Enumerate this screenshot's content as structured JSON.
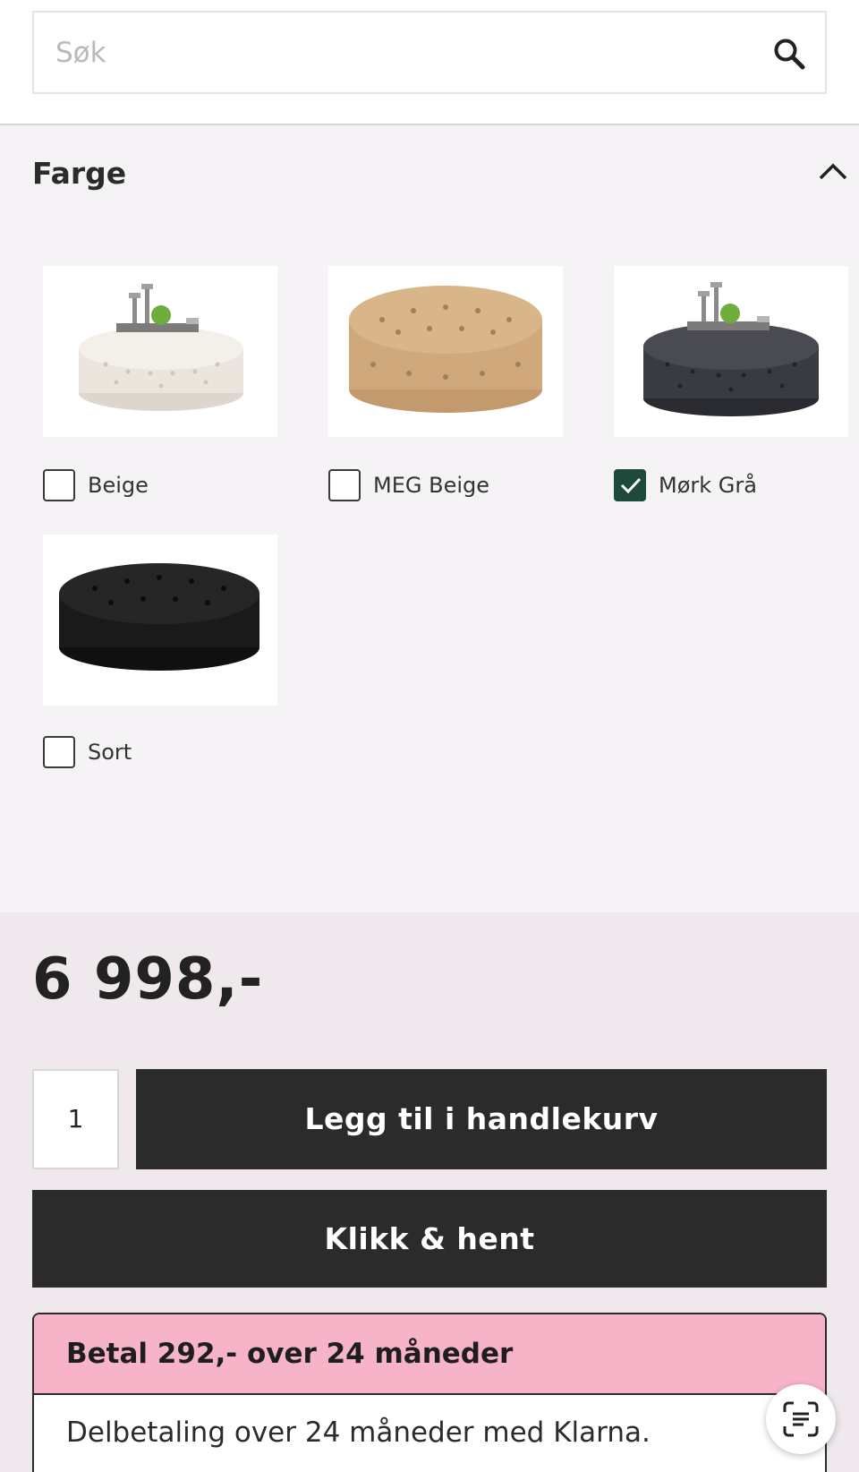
{
  "search": {
    "placeholder": "Søk"
  },
  "filter": {
    "title": "Farge",
    "options": [
      {
        "label": "Beige",
        "checked": false
      },
      {
        "label": "MEG Beige",
        "checked": false
      },
      {
        "label": "Mørk Grå",
        "checked": true
      },
      {
        "label": "Sort",
        "checked": false
      }
    ]
  },
  "product": {
    "price": "6 998,-",
    "quantity": "1",
    "add_to_cart_label": "Legg til i handlekurv",
    "click_collect_label": "Klikk & hent"
  },
  "klarna": {
    "heading": "Betal 292,- over 24 måneder",
    "text": "Delbetaling over 24 måneder med Klarna."
  },
  "colors": {
    "accent_checked": "#1f4a3b",
    "button_bg": "#2b2b2b",
    "klarna_pink": "#f7b3c8"
  },
  "icons": [
    "search-icon",
    "chevron-up-icon",
    "checkmark-icon",
    "text-scan-icon"
  ]
}
